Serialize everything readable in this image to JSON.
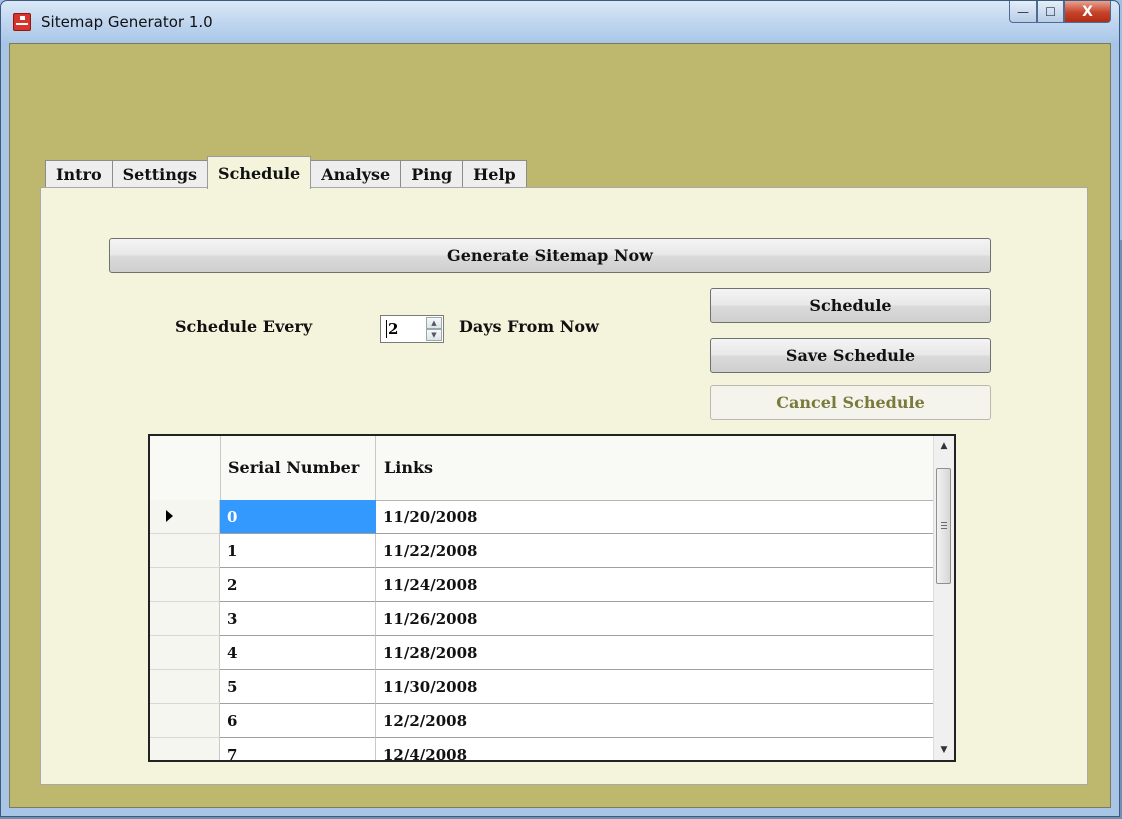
{
  "window": {
    "title": "Sitemap Generator 1.0",
    "controls": {
      "minimize": "—",
      "maximize": "☐",
      "close": "X"
    }
  },
  "tabs": [
    {
      "label": "Intro",
      "active": false
    },
    {
      "label": "Settings",
      "active": false
    },
    {
      "label": "Schedule",
      "active": true
    },
    {
      "label": "Analyse",
      "active": false
    },
    {
      "label": "Ping",
      "active": false
    },
    {
      "label": "Help",
      "active": false
    }
  ],
  "schedule": {
    "generate_label": "Generate Sitemap Now",
    "every_label": "Schedule Every",
    "days_value": "2",
    "days_label": "Days From Now",
    "schedule_label": "Schedule",
    "save_label": "Save Schedule",
    "cancel_label": "Cancel Schedule"
  },
  "grid": {
    "columns": [
      "Serial Number",
      "Links"
    ],
    "rows": [
      {
        "serial": "0",
        "link": "11/20/2008"
      },
      {
        "serial": "1",
        "link": "11/22/2008"
      },
      {
        "serial": "2",
        "link": "11/24/2008"
      },
      {
        "serial": "3",
        "link": "11/26/2008"
      },
      {
        "serial": "4",
        "link": "11/28/2008"
      },
      {
        "serial": "5",
        "link": "11/30/2008"
      },
      {
        "serial": "6",
        "link": "12/2/2008"
      },
      {
        "serial": "7",
        "link": "12/4/2008"
      }
    ],
    "selected_row": 0
  },
  "colors": {
    "client_bg": "#bdb86e",
    "panel_bg": "#f4f4dc",
    "selection": "#3399ff",
    "disabled_text": "#7a7a3c"
  }
}
